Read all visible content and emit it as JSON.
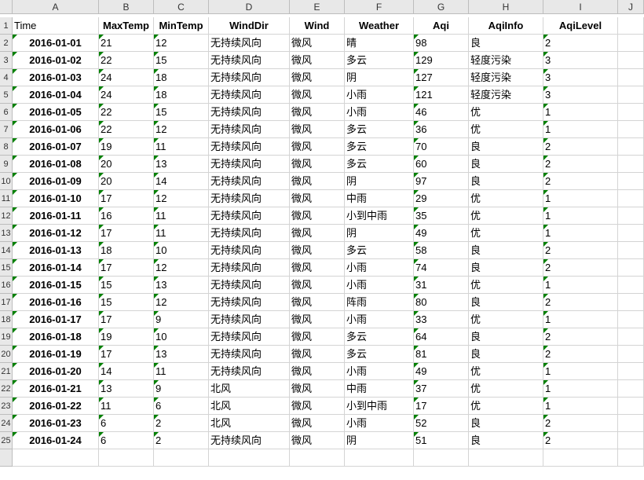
{
  "columns": [
    "A",
    "B",
    "C",
    "D",
    "E",
    "F",
    "G",
    "H",
    "I",
    "J"
  ],
  "headers": [
    "Time",
    "MaxTemp",
    "MinTemp",
    "WindDir",
    "Wind",
    "Weather",
    "Aqi",
    "AqiInfo",
    "AqiLevel"
  ],
  "rows": [
    {
      "Time": "2016-01-01",
      "MaxTemp": "21",
      "MinTemp": "12",
      "WindDir": "无持续风向",
      "Wind": "微风",
      "Weather": "晴",
      "Aqi": "98",
      "AqiInfo": "良",
      "AqiLevel": "2"
    },
    {
      "Time": "2016-01-02",
      "MaxTemp": "22",
      "MinTemp": "15",
      "WindDir": "无持续风向",
      "Wind": "微风",
      "Weather": "多云",
      "Aqi": "129",
      "AqiInfo": "轻度污染",
      "AqiLevel": "3"
    },
    {
      "Time": "2016-01-03",
      "MaxTemp": "24",
      "MinTemp": "18",
      "WindDir": "无持续风向",
      "Wind": "微风",
      "Weather": "阴",
      "Aqi": "127",
      "AqiInfo": "轻度污染",
      "AqiLevel": "3"
    },
    {
      "Time": "2016-01-04",
      "MaxTemp": "24",
      "MinTemp": "18",
      "WindDir": "无持续风向",
      "Wind": "微风",
      "Weather": "小雨",
      "Aqi": "121",
      "AqiInfo": "轻度污染",
      "AqiLevel": "3"
    },
    {
      "Time": "2016-01-05",
      "MaxTemp": "22",
      "MinTemp": "15",
      "WindDir": "无持续风向",
      "Wind": "微风",
      "Weather": "小雨",
      "Aqi": "46",
      "AqiInfo": "优",
      "AqiLevel": "1"
    },
    {
      "Time": "2016-01-06",
      "MaxTemp": "22",
      "MinTemp": "12",
      "WindDir": "无持续风向",
      "Wind": "微风",
      "Weather": "多云",
      "Aqi": "36",
      "AqiInfo": "优",
      "AqiLevel": "1"
    },
    {
      "Time": "2016-01-07",
      "MaxTemp": "19",
      "MinTemp": "11",
      "WindDir": "无持续风向",
      "Wind": "微风",
      "Weather": "多云",
      "Aqi": "70",
      "AqiInfo": "良",
      "AqiLevel": "2"
    },
    {
      "Time": "2016-01-08",
      "MaxTemp": "20",
      "MinTemp": "13",
      "WindDir": "无持续风向",
      "Wind": "微风",
      "Weather": "多云",
      "Aqi": "60",
      "AqiInfo": "良",
      "AqiLevel": "2"
    },
    {
      "Time": "2016-01-09",
      "MaxTemp": "20",
      "MinTemp": "14",
      "WindDir": "无持续风向",
      "Wind": "微风",
      "Weather": "阴",
      "Aqi": "97",
      "AqiInfo": "良",
      "AqiLevel": "2"
    },
    {
      "Time": "2016-01-10",
      "MaxTemp": "17",
      "MinTemp": "12",
      "WindDir": "无持续风向",
      "Wind": "微风",
      "Weather": "中雨",
      "Aqi": "29",
      "AqiInfo": "优",
      "AqiLevel": "1"
    },
    {
      "Time": "2016-01-11",
      "MaxTemp": "16",
      "MinTemp": "11",
      "WindDir": "无持续风向",
      "Wind": "微风",
      "Weather": "小到中雨",
      "Aqi": "35",
      "AqiInfo": "优",
      "AqiLevel": "1"
    },
    {
      "Time": "2016-01-12",
      "MaxTemp": "17",
      "MinTemp": "11",
      "WindDir": "无持续风向",
      "Wind": "微风",
      "Weather": "阴",
      "Aqi": "49",
      "AqiInfo": "优",
      "AqiLevel": "1"
    },
    {
      "Time": "2016-01-13",
      "MaxTemp": "18",
      "MinTemp": "10",
      "WindDir": "无持续风向",
      "Wind": "微风",
      "Weather": "多云",
      "Aqi": "58",
      "AqiInfo": "良",
      "AqiLevel": "2"
    },
    {
      "Time": "2016-01-14",
      "MaxTemp": "17",
      "MinTemp": "12",
      "WindDir": "无持续风向",
      "Wind": "微风",
      "Weather": "小雨",
      "Aqi": "74",
      "AqiInfo": "良",
      "AqiLevel": "2"
    },
    {
      "Time": "2016-01-15",
      "MaxTemp": "15",
      "MinTemp": "13",
      "WindDir": "无持续风向",
      "Wind": "微风",
      "Weather": "小雨",
      "Aqi": "31",
      "AqiInfo": "优",
      "AqiLevel": "1"
    },
    {
      "Time": "2016-01-16",
      "MaxTemp": "15",
      "MinTemp": "12",
      "WindDir": "无持续风向",
      "Wind": "微风",
      "Weather": "阵雨",
      "Aqi": "80",
      "AqiInfo": "良",
      "AqiLevel": "2"
    },
    {
      "Time": "2016-01-17",
      "MaxTemp": "17",
      "MinTemp": "9",
      "WindDir": "无持续风向",
      "Wind": "微风",
      "Weather": "小雨",
      "Aqi": "33",
      "AqiInfo": "优",
      "AqiLevel": "1"
    },
    {
      "Time": "2016-01-18",
      "MaxTemp": "19",
      "MinTemp": "10",
      "WindDir": "无持续风向",
      "Wind": "微风",
      "Weather": "多云",
      "Aqi": "64",
      "AqiInfo": "良",
      "AqiLevel": "2"
    },
    {
      "Time": "2016-01-19",
      "MaxTemp": "17",
      "MinTemp": "13",
      "WindDir": "无持续风向",
      "Wind": "微风",
      "Weather": "多云",
      "Aqi": "81",
      "AqiInfo": "良",
      "AqiLevel": "2"
    },
    {
      "Time": "2016-01-20",
      "MaxTemp": "14",
      "MinTemp": "11",
      "WindDir": "无持续风向",
      "Wind": "微风",
      "Weather": "小雨",
      "Aqi": "49",
      "AqiInfo": "优",
      "AqiLevel": "1"
    },
    {
      "Time": "2016-01-21",
      "MaxTemp": "13",
      "MinTemp": "9",
      "WindDir": "北风",
      "Wind": "微风",
      "Weather": "中雨",
      "Aqi": "37",
      "AqiInfo": "优",
      "AqiLevel": "1"
    },
    {
      "Time": "2016-01-22",
      "MaxTemp": "11",
      "MinTemp": "6",
      "WindDir": "北风",
      "Wind": "微风",
      "Weather": "小到中雨",
      "Aqi": "17",
      "AqiInfo": "优",
      "AqiLevel": "1"
    },
    {
      "Time": "2016-01-23",
      "MaxTemp": "6",
      "MinTemp": "2",
      "WindDir": "北风",
      "Wind": "微风",
      "Weather": "小雨",
      "Aqi": "52",
      "AqiInfo": "良",
      "AqiLevel": "2"
    },
    {
      "Time": "2016-01-24",
      "MaxTemp": "6",
      "MinTemp": "2",
      "WindDir": "无持续风向",
      "Wind": "微风",
      "Weather": "阴",
      "Aqi": "51",
      "AqiInfo": "良",
      "AqiLevel": "2"
    }
  ]
}
